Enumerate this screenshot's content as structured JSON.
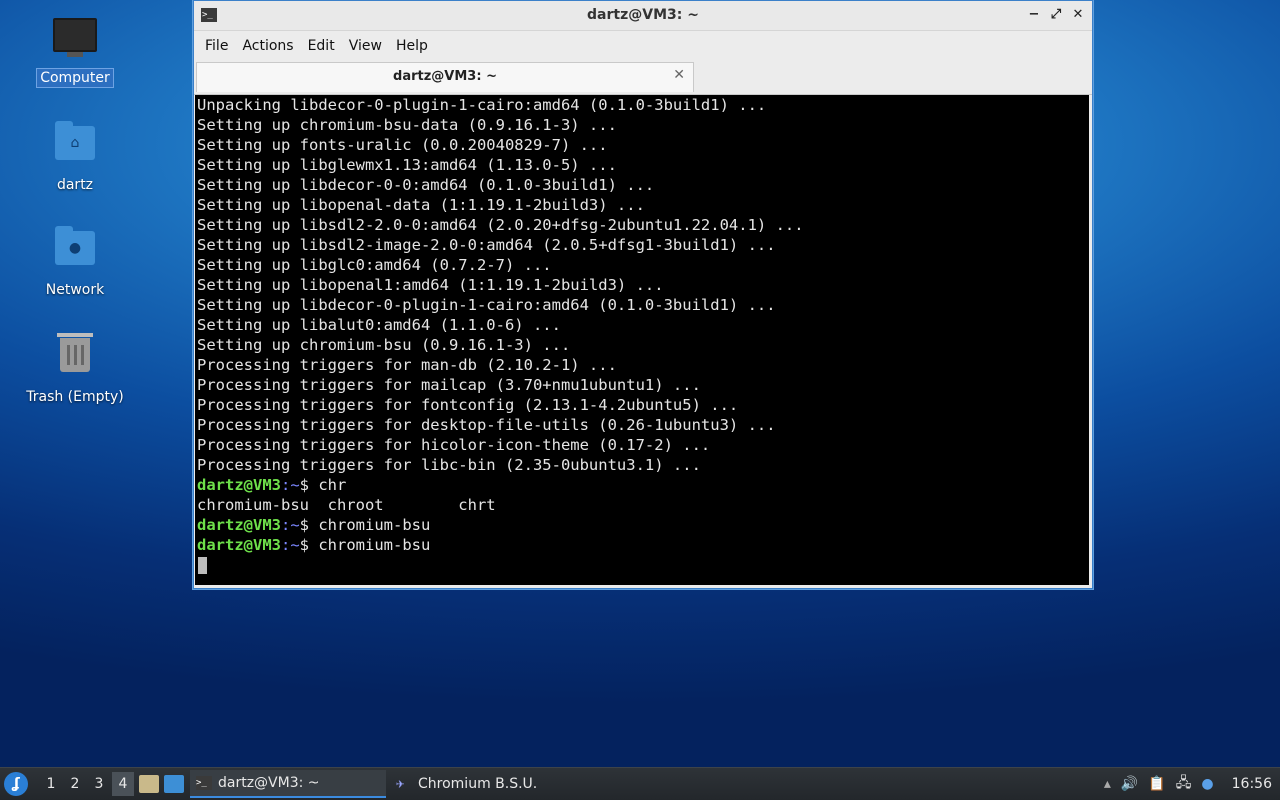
{
  "desktop": {
    "icons": [
      {
        "label": "Computer",
        "icon": "computer-icon",
        "selected": true
      },
      {
        "label": "dartz",
        "icon": "home-folder-icon"
      },
      {
        "label": "Network",
        "icon": "network-folder-icon"
      },
      {
        "label": "Trash (Empty)",
        "icon": "trash-icon"
      }
    ]
  },
  "window": {
    "title": "dartz@VM3: ~",
    "controls": {
      "minimize": "−",
      "maximize": "⤢",
      "close": "✕"
    },
    "menu": [
      "File",
      "Actions",
      "Edit",
      "View",
      "Help"
    ],
    "tab": {
      "label": "dartz@VM3: ~",
      "close": "✕"
    }
  },
  "terminal": {
    "prompt_user": "dartz@VM3",
    "prompt_path": ":~",
    "prompt_symbol": "$ ",
    "lines": [
      "Unpacking libdecor-0-plugin-1-cairo:amd64 (0.1.0-3build1) ...",
      "Setting up chromium-bsu-data (0.9.16.1-3) ...",
      "Setting up fonts-uralic (0.0.20040829-7) ...",
      "Setting up libglewmx1.13:amd64 (1.13.0-5) ...",
      "Setting up libdecor-0-0:amd64 (0.1.0-3build1) ...",
      "Setting up libopenal-data (1:1.19.1-2build3) ...",
      "Setting up libsdl2-2.0-0:amd64 (2.0.20+dfsg-2ubuntu1.22.04.1) ...",
      "Setting up libsdl2-image-2.0-0:amd64 (2.0.5+dfsg1-3build1) ...",
      "Setting up libglc0:amd64 (0.7.2-7) ...",
      "Setting up libopenal1:amd64 (1:1.19.1-2build3) ...",
      "Setting up libdecor-0-plugin-1-cairo:amd64 (0.1.0-3build1) ...",
      "Setting up libalut0:amd64 (1.1.0-6) ...",
      "Setting up chromium-bsu (0.9.16.1-3) ...",
      "Processing triggers for man-db (2.10.2-1) ...",
      "Processing triggers for mailcap (3.70+nmu1ubuntu1) ...",
      "Processing triggers for fontconfig (2.13.1-4.2ubuntu5) ...",
      "Processing triggers for desktop-file-utils (0.26-1ubuntu3) ...",
      "Processing triggers for hicolor-icon-theme (0.17-2) ...",
      "Processing triggers for libc-bin (2.35-0ubuntu3.1) ..."
    ],
    "commands": [
      {
        "cmd": "chr",
        "output": "chromium-bsu  chroot        chrt"
      },
      {
        "cmd": "chromium-bsu",
        "output": null
      },
      {
        "cmd": "chromium-bsu",
        "output": null
      }
    ]
  },
  "taskbar": {
    "workspaces": [
      "1",
      "2",
      "3",
      "4"
    ],
    "active_workspace": "4",
    "tasks": [
      {
        "label": "dartz@VM3: ~",
        "icon": "terminal-icon",
        "active": true
      },
      {
        "label": "Chromium B.S.U.",
        "icon": "chromium-bsu-icon",
        "active": false
      }
    ],
    "clock": "16:56"
  },
  "colors": {
    "accent": "#3b8be0",
    "prompt_user": "#6ee04a",
    "prompt_path": "#7c87ff"
  }
}
